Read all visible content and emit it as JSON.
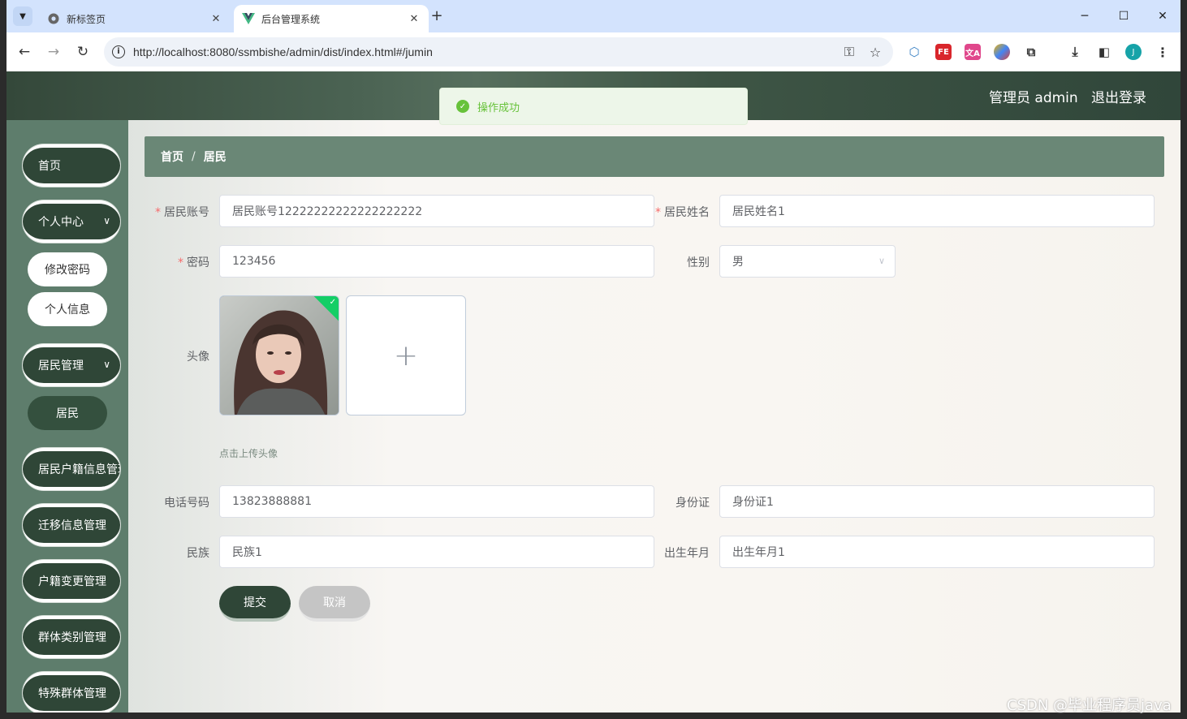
{
  "browser": {
    "tabs": [
      {
        "title": "新标签页",
        "active": false
      },
      {
        "title": "后台管理系统",
        "active": true
      }
    ],
    "url": "http://localhost:8080/ssmbishe/admin/dist/index.html#/jumin",
    "profile_initial": "J",
    "ext_labels": {
      "fe": "FE",
      "translate": "文A"
    }
  },
  "header": {
    "user": "管理员 admin",
    "logout": "退出登录"
  },
  "toast": {
    "message": "操作成功",
    "color": "#67c23a"
  },
  "sidebar": {
    "items": [
      {
        "label": "首页"
      },
      {
        "label": "个人中心"
      },
      {
        "label": "修改密码"
      },
      {
        "label": "个人信息"
      },
      {
        "label": "居民管理"
      },
      {
        "label": "居民"
      },
      {
        "label": "居民户籍信息管理"
      },
      {
        "label": "迁移信息管理"
      },
      {
        "label": "户籍变更管理"
      },
      {
        "label": "群体类别管理"
      },
      {
        "label": "特殊群体管理"
      }
    ]
  },
  "breadcrumb": {
    "home": "首页",
    "separator": "/",
    "current": "居民"
  },
  "form": {
    "account": {
      "label": "居民账号",
      "value": "居民账号12222222222222222222"
    },
    "name": {
      "label": "居民姓名",
      "value": "居民姓名1"
    },
    "password": {
      "label": "密码",
      "value": "123456"
    },
    "gender": {
      "label": "性别",
      "value": "男"
    },
    "avatar": {
      "label": "头像",
      "tip": "点击上传头像",
      "add_symbol": "+"
    },
    "phone": {
      "label": "电话号码",
      "value": "13823888881"
    },
    "idcard": {
      "label": "身份证",
      "value": "身份证1"
    },
    "ethnicity": {
      "label": "民族",
      "value": "民族1"
    },
    "birth": {
      "label": "出生年月",
      "value": "出生年月1"
    },
    "submit": "提交",
    "cancel": "取消"
  },
  "watermark": "CSDN @毕业程序员java",
  "colors": {
    "primary": "#2f4637",
    "sidebar": "#5e7d6c",
    "breadcrumb": "#6a8776",
    "required": "#f56c6c"
  }
}
